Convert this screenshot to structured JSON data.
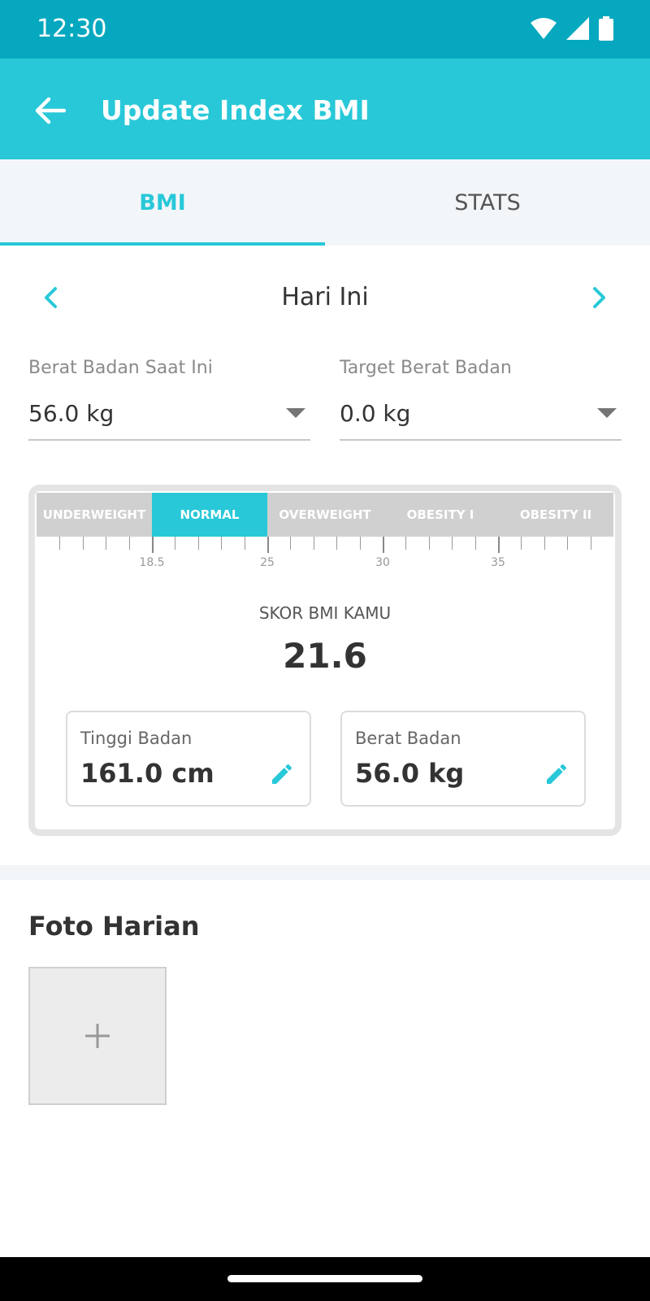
{
  "status_bar": {
    "time": "12:30",
    "icons": [
      "wifi-icon",
      "signal-icon",
      "battery-icon"
    ]
  },
  "app_bar": {
    "title": "Update Index BMI",
    "back_icon": "arrow-left-icon"
  },
  "tabs": [
    {
      "label": "BMI",
      "active": true
    },
    {
      "label": "STATS",
      "active": false
    }
  ],
  "date_nav": {
    "label": "Hari Ini",
    "prev_icon": "chevron-left-icon",
    "next_icon": "chevron-right-icon"
  },
  "fields": {
    "current_weight": {
      "label": "Berat Badan Saat Ini",
      "value": "56.0 kg"
    },
    "target_weight": {
      "label": "Target Berat Badan",
      "value": "0.0 kg"
    }
  },
  "bmi": {
    "categories": [
      {
        "label": "UNDERWEIGHT",
        "active": false
      },
      {
        "label": "NORMAL",
        "active": true
      },
      {
        "label": "OVERWEIGHT",
        "active": false
      },
      {
        "label": "OBESITY I",
        "active": false
      },
      {
        "label": "OBESITY II",
        "active": false
      }
    ],
    "scale_labels": [
      "18.5",
      "25",
      "30",
      "35"
    ],
    "score_label": "SKOR BMI KAMU",
    "score_value": "21.6",
    "height": {
      "label": "Tinggi Badan",
      "value": "161.0 cm"
    },
    "weight": {
      "label": "Berat Badan",
      "value": "56.0 kg"
    }
  },
  "photos": {
    "title": "Foto Harian",
    "add_icon": "plus-icon"
  },
  "colors": {
    "primary": "#28c8d8",
    "status_bar": "#06a8bf",
    "tab_bg": "#f2f6f9"
  }
}
